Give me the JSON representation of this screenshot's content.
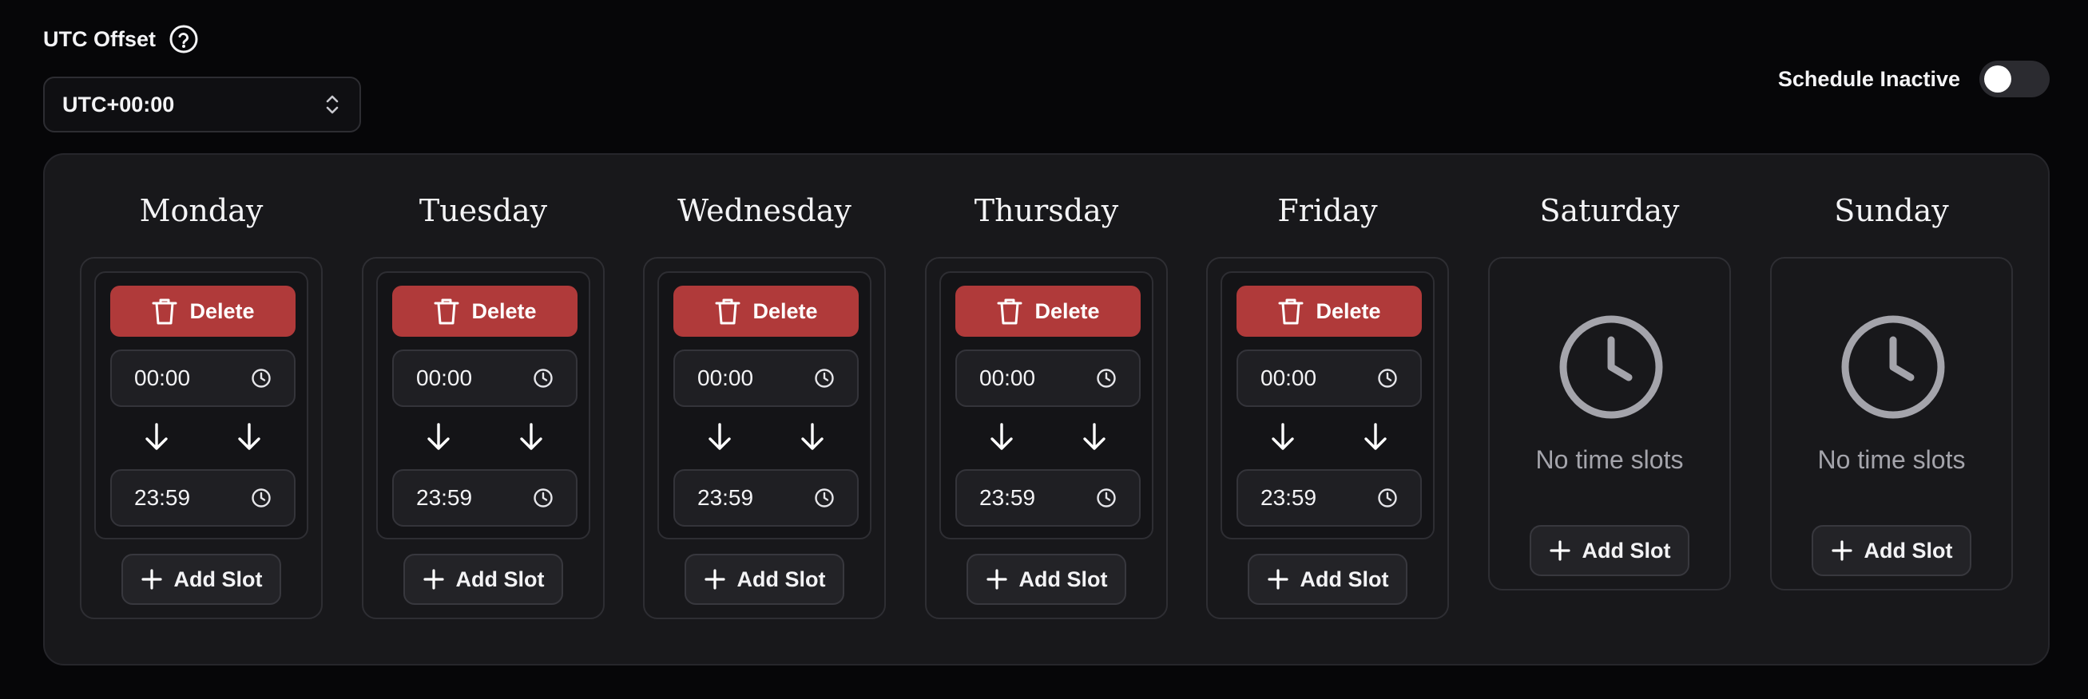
{
  "utc": {
    "label": "UTC Offset",
    "value": "UTC+00:00"
  },
  "schedule": {
    "toggle_label": "Schedule Inactive",
    "active": false
  },
  "days": [
    {
      "name": "Monday",
      "slots": [
        {
          "start": "00:00",
          "end": "23:59",
          "delete_label": "Delete"
        }
      ],
      "add_label": "Add Slot"
    },
    {
      "name": "Tuesday",
      "slots": [
        {
          "start": "00:00",
          "end": "23:59",
          "delete_label": "Delete"
        }
      ],
      "add_label": "Add Slot"
    },
    {
      "name": "Wednesday",
      "slots": [
        {
          "start": "00:00",
          "end": "23:59",
          "delete_label": "Delete"
        }
      ],
      "add_label": "Add Slot"
    },
    {
      "name": "Thursday",
      "slots": [
        {
          "start": "00:00",
          "end": "23:59",
          "delete_label": "Delete"
        }
      ],
      "add_label": "Add Slot"
    },
    {
      "name": "Friday",
      "slots": [
        {
          "start": "00:00",
          "end": "23:59",
          "delete_label": "Delete"
        }
      ],
      "add_label": "Add Slot"
    },
    {
      "name": "Saturday",
      "slots": [],
      "empty_label": "No time slots",
      "add_label": "Add Slot"
    },
    {
      "name": "Sunday",
      "slots": [],
      "empty_label": "No time slots",
      "add_label": "Add Slot"
    }
  ],
  "colors": {
    "delete": "#b03a3a",
    "panel": "#18181b",
    "background": "#060608"
  },
  "icons": [
    "help-icon",
    "chevron-up-down-icon",
    "trash-icon",
    "clock-icon",
    "arrow-down-icon",
    "plus-icon"
  ]
}
